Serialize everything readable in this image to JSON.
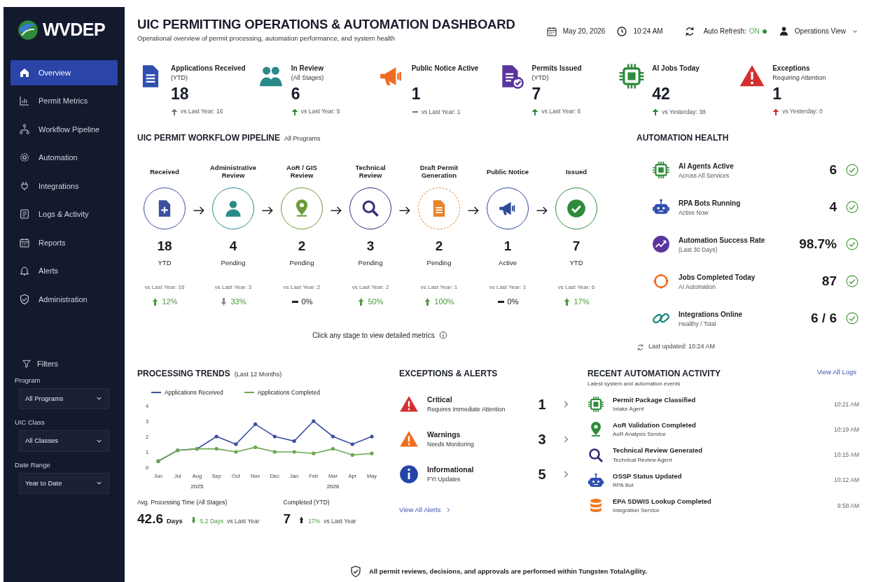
{
  "sidebar": {
    "logo": "WVDEP",
    "items": [
      {
        "label": "Overview",
        "selected": true
      },
      {
        "label": "Permit Metrics",
        "selected": false
      },
      {
        "label": "Workflow Pipeline",
        "selected": false
      },
      {
        "label": "Automation",
        "selected": false
      },
      {
        "label": "Integrations",
        "selected": false
      },
      {
        "label": "Logs & Activity",
        "selected": false
      },
      {
        "label": "Reports",
        "selected": false
      },
      {
        "label": "Alerts",
        "selected": false
      },
      {
        "label": "Administration",
        "selected": false
      }
    ],
    "filters": {
      "title": "Filters",
      "fields": [
        {
          "label": "Program",
          "value": "All Programs"
        },
        {
          "label": "UIC Class",
          "value": "All Classes"
        },
        {
          "label": "Date Range",
          "value": "Year to Date"
        }
      ]
    }
  },
  "header": {
    "title": "UIC PERMITTING OPERATIONS & AUTOMATION DASHBOARD",
    "subtitle": "Operational overview of permit processing, automation performance, and system health",
    "date": "May 20, 2026",
    "time": "10:24 AM",
    "auto_refresh": {
      "label": "Auto Refresh:",
      "state": "ON",
      "on": true
    },
    "view": "Operations View"
  },
  "kpis": [
    {
      "title": "Applications Received",
      "subtitle": "(YTD)",
      "value": "18",
      "kind": "up",
      "color": "#777777",
      "comparison": "vs Last Year: 16"
    },
    {
      "title": "In Review",
      "subtitle": "(All Stages)",
      "value": "6",
      "kind": "up",
      "color": "#2e8b3a",
      "comparison": "vs Last Year: 5"
    },
    {
      "title": "Public Notice Active",
      "value": "1",
      "kind": "flat",
      "color": "#777777",
      "comparison": "vs Last Year: 1"
    },
    {
      "title": "Permits Issued",
      "subtitle": "(YTD)",
      "value": "7",
      "kind": "up",
      "color": "#2e8b3a",
      "comparison": "vs Last Year: 6"
    },
    {
      "title": "AI Jobs Today",
      "value": "42",
      "kind": "up",
      "color": "#2e8b3a",
      "comparison": "vs Yesterday: 38"
    },
    {
      "title": "Exceptions",
      "subtitle": "Requiring Attention",
      "value": "1",
      "kind": "up",
      "color": "#d32f2f",
      "comparison": "vs Yesterday: 0"
    }
  ],
  "pipeline": {
    "title": "UIC PERMIT WORKFLOW PIPELINE",
    "scope": "All Programs",
    "stages": [
      {
        "label": "Received",
        "value": "18",
        "unit": "YTD",
        "comparison": "vs Last Year: 16",
        "kind": "up",
        "change": "12%",
        "color": "#3b4ea0"
      },
      {
        "label": "Administrative Review",
        "value": "4",
        "unit": "Pending",
        "comparison": "vs Last Year: 3",
        "kind": "down",
        "change": "33%",
        "color": "#2a8a8a"
      },
      {
        "label": "AoR / GIS Review",
        "value": "2",
        "unit": "Pending",
        "comparison": "vs Last Year: 2",
        "kind": "flat",
        "change": "0%",
        "color": "#6a9a3a"
      },
      {
        "label": "Technical Review",
        "value": "3",
        "unit": "Pending",
        "comparison": "vs Last Year: 2",
        "kind": "up",
        "change": "50%",
        "color": "#3d2a7a"
      },
      {
        "label": "Draft Permit Generation",
        "value": "2",
        "unit": "Pending",
        "comparison": "vs Last Year: 1",
        "kind": "up",
        "change": "100%",
        "color": "#e8832a"
      },
      {
        "label": "Public Notice",
        "value": "1",
        "unit": "Active",
        "comparison": "vs Last Year: 1",
        "kind": "flat",
        "change": "0%",
        "color": "#2d4a9a"
      },
      {
        "label": "Issued",
        "value": "7",
        "unit": "YTD",
        "comparison": "vs Last Year: 6",
        "kind": "up",
        "change": "17%",
        "color": "#2e8b3a"
      }
    ],
    "note": "Click any stage to view detailed metrics"
  },
  "automation_health": {
    "title": "AUTOMATION HEALTH",
    "items": [
      {
        "title": "AI Agents Active",
        "subtitle": "Across All Services",
        "value": "6"
      },
      {
        "title": "RPA Bots Running",
        "subtitle": "Active Now",
        "value": "4"
      },
      {
        "title": "Automation Success Rate",
        "subtitle": "(Last 30 Days)",
        "value": "98.7%"
      },
      {
        "title": "Jobs Completed Today",
        "subtitle": "AI Automation",
        "value": "87"
      },
      {
        "title": "Integrations Online",
        "subtitle": "Healthy / Total",
        "value": "6 / 6"
      }
    ],
    "updated": "Last updated: 10:24 AM"
  },
  "trends": {
    "title": "PROCESSING TRENDS",
    "period": "(Last 12 Months)",
    "chart_data": {
      "type": "line",
      "categories": [
        "Jun",
        "Jul",
        "Aug",
        "Sep",
        "Oct",
        "Nov",
        "Dec",
        "Jan",
        "Feb",
        "Mar",
        "Apr",
        "May"
      ],
      "ylim": [
        0,
        4
      ],
      "yticks": [
        0,
        1,
        2,
        3,
        4
      ],
      "series": [
        {
          "name": "Applications Received",
          "color": "#3b4ea0",
          "values": [
            0.4,
            1.1,
            1.2,
            2,
            1.5,
            2.8,
            2,
            1.7,
            3,
            2,
            1.5,
            2
          ]
        },
        {
          "name": "Applications Completed",
          "color": "#6aa84f",
          "values": [
            0.4,
            1.1,
            1.2,
            1.2,
            1,
            1.3,
            1,
            1,
            0.9,
            1.2,
            0.8,
            0.9
          ]
        }
      ]
    },
    "year_labels": [
      "2025",
      "2026"
    ],
    "stats": [
      {
        "label": "Avg. Processing Time (All Stages)",
        "value": "42.6",
        "unit": "Days",
        "kind": "down",
        "change": "5.2 Days",
        "comparison": "vs Last Year"
      },
      {
        "label": "Completed (YTD)",
        "value": "7",
        "kind": "up",
        "change": "17%",
        "comparison": "vs Last Year"
      }
    ]
  },
  "exceptions": {
    "title": "EXCEPTIONS & ALERTS",
    "items": [
      {
        "kind": "critical",
        "title": "Critical",
        "subtitle": "Requires Immediate Attention",
        "count": "1"
      },
      {
        "kind": "warning",
        "title": "Warnings",
        "subtitle": "Needs Monitoring",
        "count": "3"
      },
      {
        "kind": "info",
        "title": "Informational",
        "subtitle": "FYI Updates",
        "count": "5"
      }
    ],
    "link": "View All Alerts"
  },
  "activity": {
    "title": "RECENT AUTOMATION ACTIVITY",
    "subtitle": "Latest system and automation events",
    "link": "View All Logs",
    "items": [
      {
        "title": "Permit Package Classified",
        "source": "Intake Agent",
        "time": "10:21 AM"
      },
      {
        "title": "AoR Validation Completed",
        "source": "AoR Analysis Service",
        "time": "10:19 AM"
      },
      {
        "title": "Technical Review Generated",
        "source": "Technical Review Agent",
        "time": "10:15 AM"
      },
      {
        "title": "OSSP Status Updated",
        "source": "RPA Bot",
        "time": "10:12 AM"
      },
      {
        "title": "EPA SDWIS Lookup Completed",
        "source": "Integration Service",
        "time": "9:58 AM"
      }
    ]
  },
  "footer": "All permit reviews, decisions, and approvals are performed within Tungsten TotalAgility."
}
